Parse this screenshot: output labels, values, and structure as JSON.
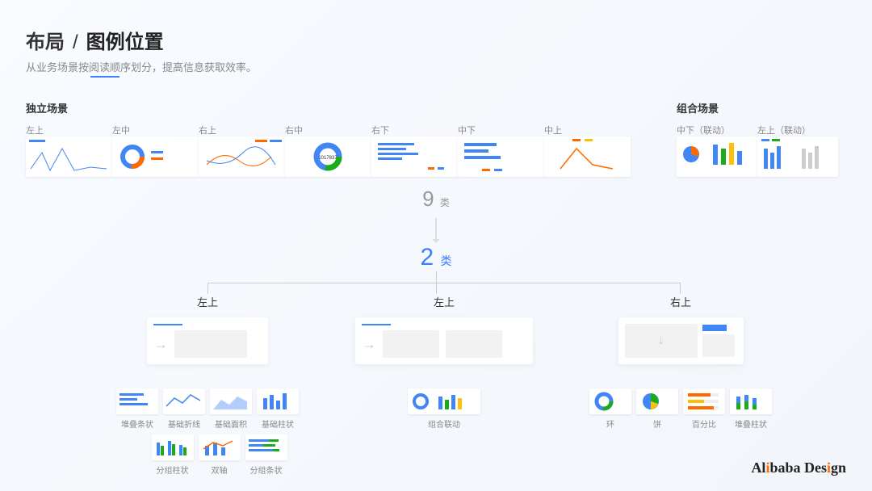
{
  "header": {
    "prefix": "布局",
    "slash": "/",
    "title": "图例位置",
    "subtitle": "从业务场景按阅读顺序划分，提高信息获取效率。"
  },
  "scene_left": {
    "title": "独立场景",
    "positions": [
      "左上",
      "左中",
      "右上",
      "右中",
      "右下",
      "中下",
      "中上"
    ]
  },
  "scene_right": {
    "title": "组合场景",
    "positions": [
      "中下（联动）",
      "左上（联动）"
    ]
  },
  "count_types": {
    "value": "9",
    "unit": "类"
  },
  "count_result": {
    "value": "2",
    "unit": "类"
  },
  "branches": [
    {
      "label": "左上",
      "charts": [
        "堆叠条状",
        "基础折线",
        "基础面积",
        "基础柱状"
      ],
      "charts2": [
        "分组柱状",
        "双轴",
        "分组条状"
      ]
    },
    {
      "label": "左上",
      "charts": [
        "组合联动"
      ]
    },
    {
      "label": "右上",
      "charts": [
        "环",
        "饼",
        "百分比",
        "堆叠柱状"
      ]
    }
  ],
  "brand": {
    "a": "Al",
    "b": "i",
    "c": "baba Des",
    "d": "i",
    "e": "gn"
  }
}
